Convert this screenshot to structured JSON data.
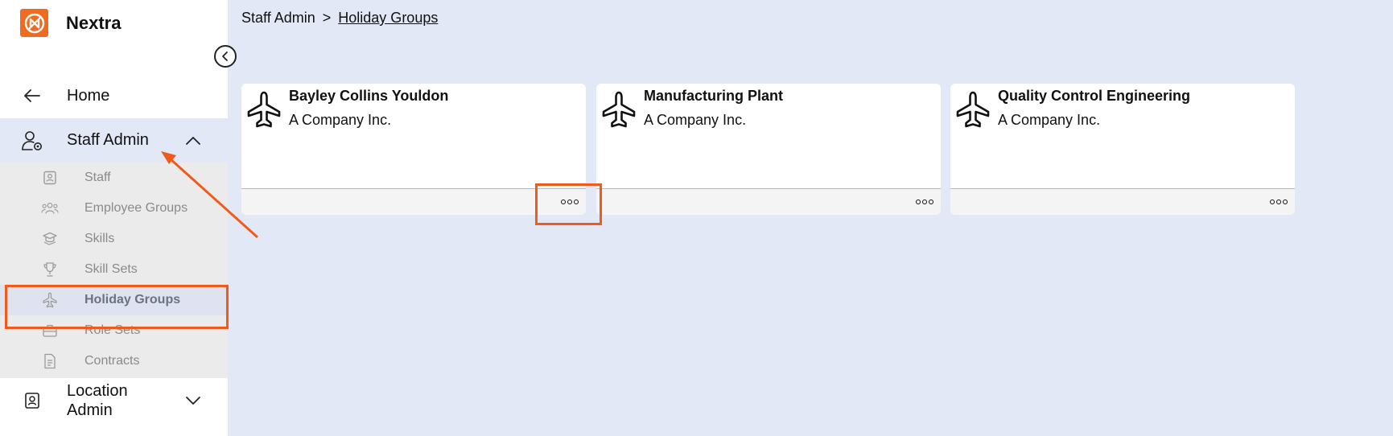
{
  "app": {
    "name": "Nextra",
    "accent": "#ee6b1f"
  },
  "sidebar": {
    "collapse_icon": "chevron-left-icon",
    "home": {
      "label": "Home",
      "icon": "arrow-left-icon"
    },
    "staff_admin": {
      "label": "Staff Admin",
      "icon": "user-gear-icon",
      "expanded": true,
      "items": [
        {
          "label": "Staff",
          "icon": "id-badge-icon"
        },
        {
          "label": "Employee Groups",
          "icon": "users-icon"
        },
        {
          "label": "Skills",
          "icon": "graduation-cap-icon"
        },
        {
          "label": "Skill Sets",
          "icon": "trophy-icon"
        },
        {
          "label": "Holiday Groups",
          "icon": "plane-icon",
          "active": true
        },
        {
          "label": "Role Sets",
          "icon": "briefcase-icon"
        },
        {
          "label": "Contracts",
          "icon": "document-icon"
        }
      ]
    },
    "location_admin": {
      "label_line1": "Location",
      "label_line2": "Admin",
      "icon": "id-card-icon",
      "expanded": false
    }
  },
  "breadcrumb": {
    "parent": "Staff Admin",
    "separator": ">",
    "current": "Holiday Groups"
  },
  "cards": [
    {
      "title": "Bayley Collins Youldon",
      "subtitle": "A Company Inc.",
      "icon": "plane-icon",
      "menu_icon": "more-options-icon"
    },
    {
      "title": "Manufacturing Plant",
      "subtitle": "A Company Inc.",
      "icon": "plane-icon",
      "menu_icon": "more-options-icon"
    },
    {
      "title": "Quality Control Engineering",
      "subtitle": "A Company Inc.",
      "icon": "plane-icon",
      "menu_icon": "more-options-icon"
    }
  ],
  "annotations": {
    "color": "#f05a1a"
  }
}
